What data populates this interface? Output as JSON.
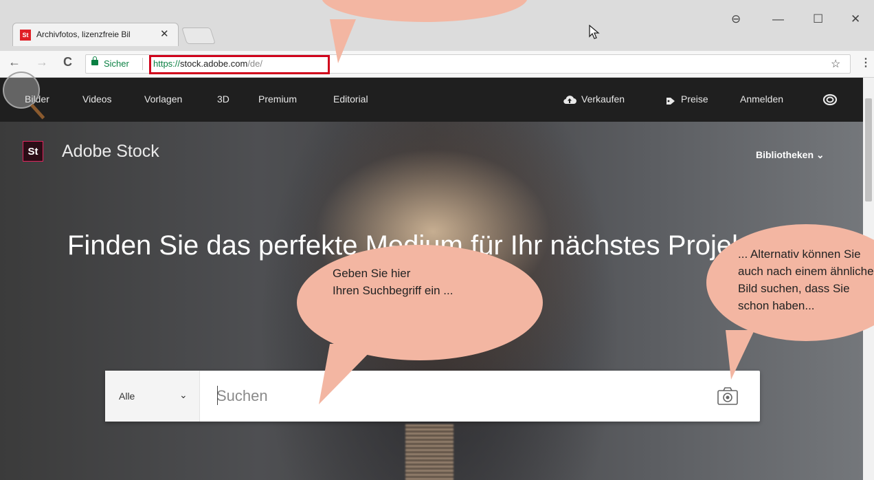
{
  "browser": {
    "tab_title": "Archivfotos, lizenzfreie Bil",
    "tab_close": "✕",
    "favicon_text": "St",
    "secure_label": "Sicher",
    "url_protocol": "https://",
    "url_host": "stock.adobe.com",
    "url_path": "/de/",
    "window_controls": {
      "account": "⊖",
      "minimize": "—",
      "maximize": "☐",
      "close": "✕"
    },
    "nav": {
      "back": "←",
      "forward": "→",
      "reload": "C"
    },
    "star": "☆",
    "menu": "⋮"
  },
  "site_nav": {
    "left_links": [
      "Bilder",
      "Videos",
      "Vorlagen",
      "3D",
      "Premium",
      "Editorial"
    ],
    "sell": "Verkaufen",
    "prices": "Preise",
    "login": "Anmelden"
  },
  "hero": {
    "logo_text": "St",
    "brand": "Adobe Stock",
    "libraries": "Bibliotheken",
    "libraries_chevron": "⌄",
    "headline": "Finden Sie das perfekte Medium für Ihr nächstes Projekt"
  },
  "search": {
    "filter_value": "Alle",
    "filter_chevron": "⌄",
    "placeholder": "Suchen",
    "value": ""
  },
  "annotations": {
    "left_line1": "Geben Sie hier",
    "left_line2": "Ihren Suchbegriff ein ...",
    "right_line1": "... Alternativ können Sie",
    "right_line2": "auch nach einem ähnlichen",
    "right_line3": "Bild suchen, dass Sie",
    "right_line4": "schon haben..."
  },
  "colors": {
    "brand_pink": "#e0245e",
    "bubble": "#f3b6a2",
    "secure_green": "#0b8043",
    "highlight_red": "#d0021b",
    "nav_bg": "#1f1f1f"
  }
}
